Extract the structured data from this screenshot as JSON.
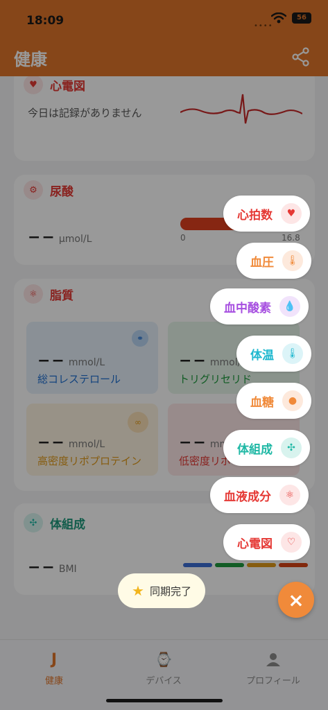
{
  "status_bar": {
    "time": "18:09",
    "battery": "56"
  },
  "app_bar": {
    "title": "健康"
  },
  "ecg_card": {
    "title": "心電図",
    "empty_text": "今日は記録がありません"
  },
  "uric_card": {
    "title": "尿酸",
    "value": "−−",
    "unit": "μmol/L",
    "range_min": "0",
    "range_max": "16.8"
  },
  "lipid_card": {
    "title": "脂質",
    "tiles": [
      {
        "value": "−−",
        "unit": "mmol/L",
        "label": "総コレステロール"
      },
      {
        "value": "−−",
        "unit": "mmol/L",
        "label": "トリグリセリド"
      },
      {
        "value": "−−",
        "unit": "mmol/L",
        "label": "高密度リポプロテイン"
      },
      {
        "value": "−−",
        "unit": "mmol/L",
        "label": "低密度リポ"
      }
    ]
  },
  "body_card": {
    "title": "体組成",
    "value": "−−",
    "unit": "BMI"
  },
  "fab_menu": {
    "items": [
      {
        "label": "心拍数",
        "color": "#e53935",
        "icon": "heart-icon"
      },
      {
        "label": "血圧",
        "color": "#f08a3a",
        "icon": "thermometer-icon"
      },
      {
        "label": "血中酸素",
        "color": "#a64ee0",
        "icon": "drop-icon"
      },
      {
        "label": "体温",
        "color": "#20b8cf",
        "icon": "thermometer-icon"
      },
      {
        "label": "血糖",
        "color": "#f08a3a",
        "icon": "glucose-icon"
      },
      {
        "label": "体組成",
        "color": "#1fb8a5",
        "icon": "molecule-icon"
      },
      {
        "label": "血液成分",
        "color": "#e53935",
        "icon": "blood-component-icon"
      },
      {
        "label": "心電図",
        "color": "#e53935",
        "icon": "ecg-heart-icon"
      }
    ],
    "close_label": "×"
  },
  "toast": {
    "text": "同期完了"
  },
  "bottom_nav": {
    "items": [
      {
        "label": "健康"
      },
      {
        "label": "デバイス"
      },
      {
        "label": "プロフィール"
      }
    ]
  },
  "colors": {
    "accent": "#e0752a",
    "fab_close": "#f08a3a"
  }
}
